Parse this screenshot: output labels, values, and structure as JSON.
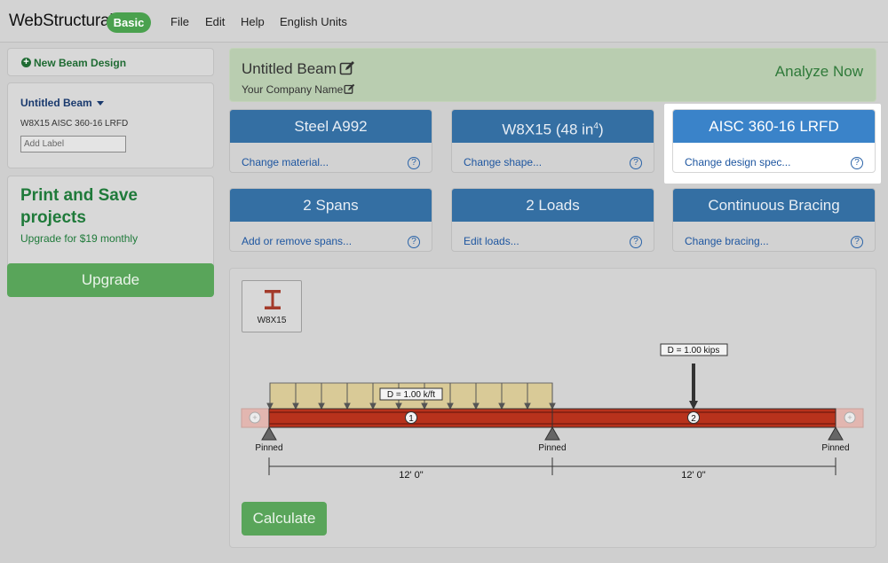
{
  "app": {
    "brand": "WebStructural",
    "plan_badge": "Basic",
    "menu": [
      "File",
      "Edit",
      "Help",
      "English Units"
    ]
  },
  "sidebar": {
    "new_beam_label": "New Beam Design",
    "beam_name": "Untitled Beam",
    "beam_spec": "W8X15 AISC 360-16 LRFD",
    "label_placeholder": "Add Label",
    "promo_title": "Print and Save projects",
    "promo_subtitle": "Upgrade for $19 monthly",
    "upgrade_label": "Upgrade"
  },
  "header": {
    "title": "Untitled Beam",
    "company": "Your Company Name",
    "analyze_label": "Analyze Now"
  },
  "cards": [
    {
      "title": "Steel A992",
      "link": "Change material..."
    },
    {
      "title": "W8X15 (48 in",
      "title_sup": "4",
      "title_end": ")",
      "link": "Change shape..."
    },
    {
      "title": "AISC 360-16 LRFD",
      "link": "Change design spec..."
    },
    {
      "title": "2 Spans",
      "link": "Add or remove spans..."
    },
    {
      "title": "2 Loads",
      "link": "Edit loads..."
    },
    {
      "title": "Continuous Bracing",
      "link": "Change bracing..."
    }
  ],
  "help_glyph": "?",
  "diagram": {
    "shape_label": "W8X15",
    "distributed_load_label": "D = 1.00 k/ft",
    "point_load_label": "D = 1.00 kips",
    "span_numbers": [
      "1",
      "2"
    ],
    "supports": [
      "Pinned",
      "Pinned",
      "Pinned"
    ],
    "span_lengths": [
      "12' 0\"",
      "12' 0\""
    ],
    "calculate_label": "Calculate"
  },
  "colors": {
    "accent_green": "#4aa14e",
    "card_header_blue": "#346fa3",
    "beam_red": "#b8321c",
    "load_fill": "#d9ca97"
  }
}
